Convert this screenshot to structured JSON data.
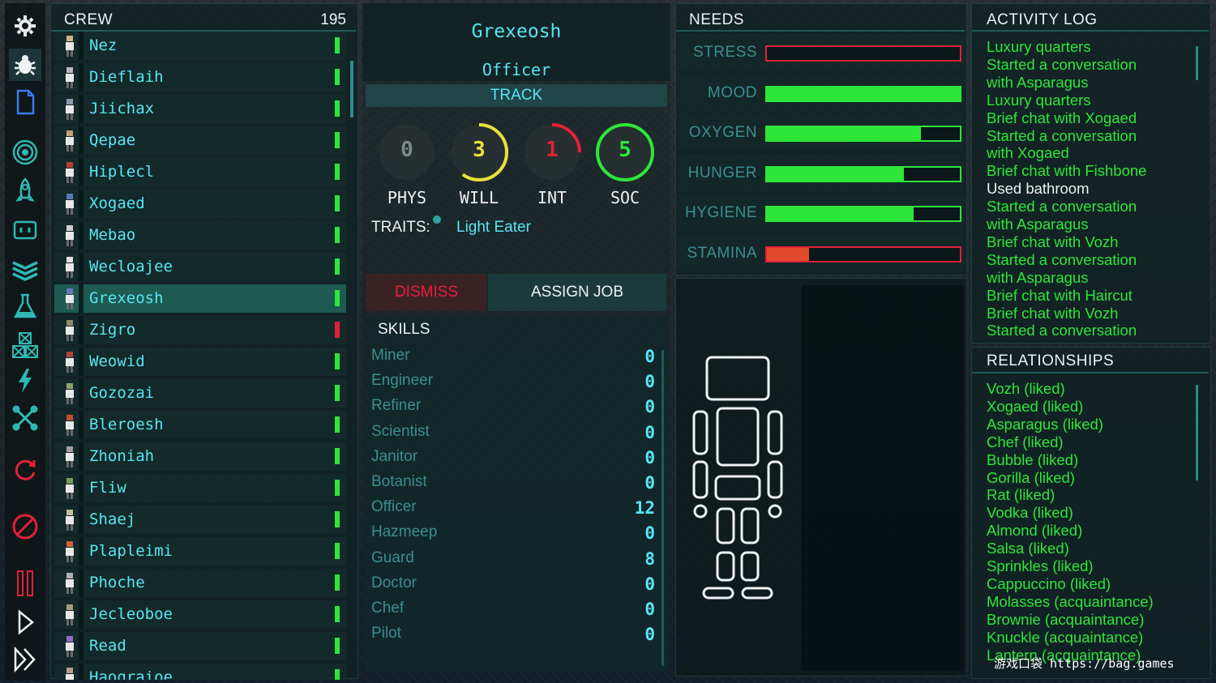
{
  "toolbar": {
    "items": [
      {
        "icon": "gear-icon"
      },
      {
        "icon": "bug-icon"
      },
      {
        "icon": "document-icon"
      },
      {
        "icon": "radar-icon"
      },
      {
        "icon": "rocket-icon"
      },
      {
        "icon": "socket-icon"
      },
      {
        "icon": "layers-icon"
      },
      {
        "icon": "flask-icon"
      },
      {
        "icon": "crates-icon"
      },
      {
        "icon": "lightning-icon"
      },
      {
        "icon": "tools-icon"
      },
      {
        "icon": "refresh-icon"
      },
      {
        "icon": "cancel-icon"
      },
      {
        "icon": "pause-icon"
      },
      {
        "icon": "play-icon"
      },
      {
        "icon": "fast-forward-icon"
      }
    ]
  },
  "crew": {
    "title": "CREW",
    "count": "195",
    "members": [
      {
        "name": "Nez",
        "status": "green"
      },
      {
        "name": "Dieflaih",
        "status": "green"
      },
      {
        "name": "Jiichax",
        "status": "green"
      },
      {
        "name": "Qepae",
        "status": "green"
      },
      {
        "name": "Hiplecl",
        "status": "green"
      },
      {
        "name": "Xogaed",
        "status": "green"
      },
      {
        "name": "Mebao",
        "status": "green"
      },
      {
        "name": "Wecloajee",
        "status": "green"
      },
      {
        "name": "Grexeosh",
        "status": "green",
        "selected": true
      },
      {
        "name": "Zigro",
        "status": "red"
      },
      {
        "name": "Weowid",
        "status": "green"
      },
      {
        "name": "Gozozai",
        "status": "green"
      },
      {
        "name": "Bleroesh",
        "status": "green"
      },
      {
        "name": "Zhoniah",
        "status": "green"
      },
      {
        "name": "Fliw",
        "status": "green"
      },
      {
        "name": "Shaej",
        "status": "green"
      },
      {
        "name": "Plapleimi",
        "status": "green"
      },
      {
        "name": "Phoche",
        "status": "green"
      },
      {
        "name": "Jecleoboe",
        "status": "green"
      },
      {
        "name": "Read",
        "status": "green"
      },
      {
        "name": "Haograioe",
        "status": "green"
      }
    ]
  },
  "character": {
    "name": "Grexeosh",
    "role": "Officer",
    "track_label": "TRACK",
    "stats": [
      {
        "label": "PHYS",
        "value": "0",
        "color": "#7d8a8a",
        "fill": 0
      },
      {
        "label": "WILL",
        "value": "3",
        "color": "#e8e23a",
        "fill": 0.6
      },
      {
        "label": "INT",
        "value": "1",
        "color": "#e3203a",
        "fill": 0.25
      },
      {
        "label": "SOC",
        "value": "5",
        "color": "#2ee63a",
        "fill": 1.0
      }
    ],
    "traits_label": "TRAITS:",
    "traits": [
      "Light Eater"
    ],
    "dismiss_label": "DISMISS",
    "assign_label": "ASSIGN JOB"
  },
  "skills": {
    "title": "SKILLS",
    "items": [
      {
        "name": "Miner",
        "value": "0"
      },
      {
        "name": "Engineer",
        "value": "0"
      },
      {
        "name": "Refiner",
        "value": "0"
      },
      {
        "name": "Scientist",
        "value": "0"
      },
      {
        "name": "Janitor",
        "value": "0"
      },
      {
        "name": "Botanist",
        "value": "0"
      },
      {
        "name": "Officer",
        "value": "12"
      },
      {
        "name": "Hazmeep",
        "value": "0"
      },
      {
        "name": "Guard",
        "value": "8"
      },
      {
        "name": "Doctor",
        "value": "0"
      },
      {
        "name": "Chef",
        "value": "0"
      },
      {
        "name": "Pilot",
        "value": "0"
      }
    ]
  },
  "needs": {
    "title": "NEEDS",
    "items": [
      {
        "label": "STRESS",
        "level": 0.0,
        "color": "#e3203a",
        "fill_color": "#e3203a",
        "border": "red"
      },
      {
        "label": "MOOD",
        "level": 1.0,
        "color": "#2ee63a",
        "fill_color": "#2ee63a",
        "border": "green"
      },
      {
        "label": "OXYGEN",
        "level": 0.8,
        "color": "#2ee63a",
        "fill_color": "#2ee63a",
        "border": "green"
      },
      {
        "label": "HUNGER",
        "level": 0.71,
        "color": "#2ee63a",
        "fill_color": "#2ee63a",
        "border": "green"
      },
      {
        "label": "HYGIENE",
        "level": 0.76,
        "color": "#2ee63a",
        "fill_color": "#2ee63a",
        "border": "green"
      },
      {
        "label": "STAMINA",
        "level": 0.22,
        "color": "#e3203a",
        "fill_color": "#e34a2a",
        "border": "red"
      }
    ]
  },
  "activity_log": {
    "title": "ACTIVITY LOG",
    "entries": [
      {
        "text": "Luxury quarters",
        "white": false
      },
      {
        "text": "Started a conversation",
        "white": false
      },
      {
        "text": "with Asparagus",
        "white": false
      },
      {
        "text": "Luxury quarters",
        "white": false
      },
      {
        "text": "Brief chat with Xogaed",
        "white": false
      },
      {
        "text": "Started a conversation",
        "white": false
      },
      {
        "text": "with Xogaed",
        "white": false
      },
      {
        "text": "Brief chat with Fishbone",
        "white": false
      },
      {
        "text": "Used bathroom",
        "white": true
      },
      {
        "text": "Started a conversation",
        "white": false
      },
      {
        "text": "with Asparagus",
        "white": false
      },
      {
        "text": "Brief chat with Vozh",
        "white": false
      },
      {
        "text": "Started a conversation",
        "white": false
      },
      {
        "text": "with Asparagus",
        "white": false
      },
      {
        "text": "Brief chat with Haircut",
        "white": false
      },
      {
        "text": "Brief chat with Vozh",
        "white": false
      },
      {
        "text": "Started a conversation",
        "white": false
      }
    ]
  },
  "relationships": {
    "title": "RELATIONSHIPS",
    "entries": [
      "Vozh (liked)",
      "Xogaed (liked)",
      "Asparagus (liked)",
      "Chef (liked)",
      "Bubble (liked)",
      "Gorilla (liked)",
      "Rat (liked)",
      "Vodka (liked)",
      "Almond (liked)",
      "Salsa (liked)",
      "Sprinkles (liked)",
      "Cappuccino (liked)",
      "Molasses (acquaintance)",
      "Brownie (acquaintance)",
      "Knuckle (acquaintance)",
      "Lantern (acquaintance)"
    ]
  },
  "watermark": "游戏口袋 https://bag.games",
  "colors": {
    "accent": "#57e6f2",
    "good": "#2ee63a",
    "bad": "#e3203a",
    "warn": "#e8e23a"
  }
}
